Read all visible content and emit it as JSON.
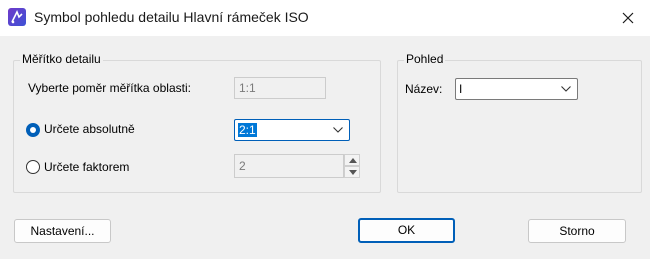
{
  "window": {
    "title": "Symbol pohledu detailu Hlavní rámeček ISO",
    "app_icon": "app-logo-icon",
    "close_icon": "close-icon"
  },
  "scale_group": {
    "legend": "Měřítko detailu",
    "area_ratio_label": "Vyberte poměr měřítka oblasti:",
    "area_ratio_value": "1:1",
    "absolute_radio_label": "Určete absolutně",
    "absolute_radio_checked": true,
    "absolute_value": "2:1",
    "factor_radio_label": "Určete faktorem",
    "factor_radio_checked": false,
    "factor_value": "2"
  },
  "view_group": {
    "legend": "Pohled",
    "name_label": "Název:",
    "name_value": "I"
  },
  "buttons": {
    "settings": "Nastavení...",
    "ok": "OK",
    "cancel": "Storno"
  },
  "colors": {
    "accent": "#005fb8",
    "selection": "#0078d7",
    "background": "#f0f0f0"
  }
}
